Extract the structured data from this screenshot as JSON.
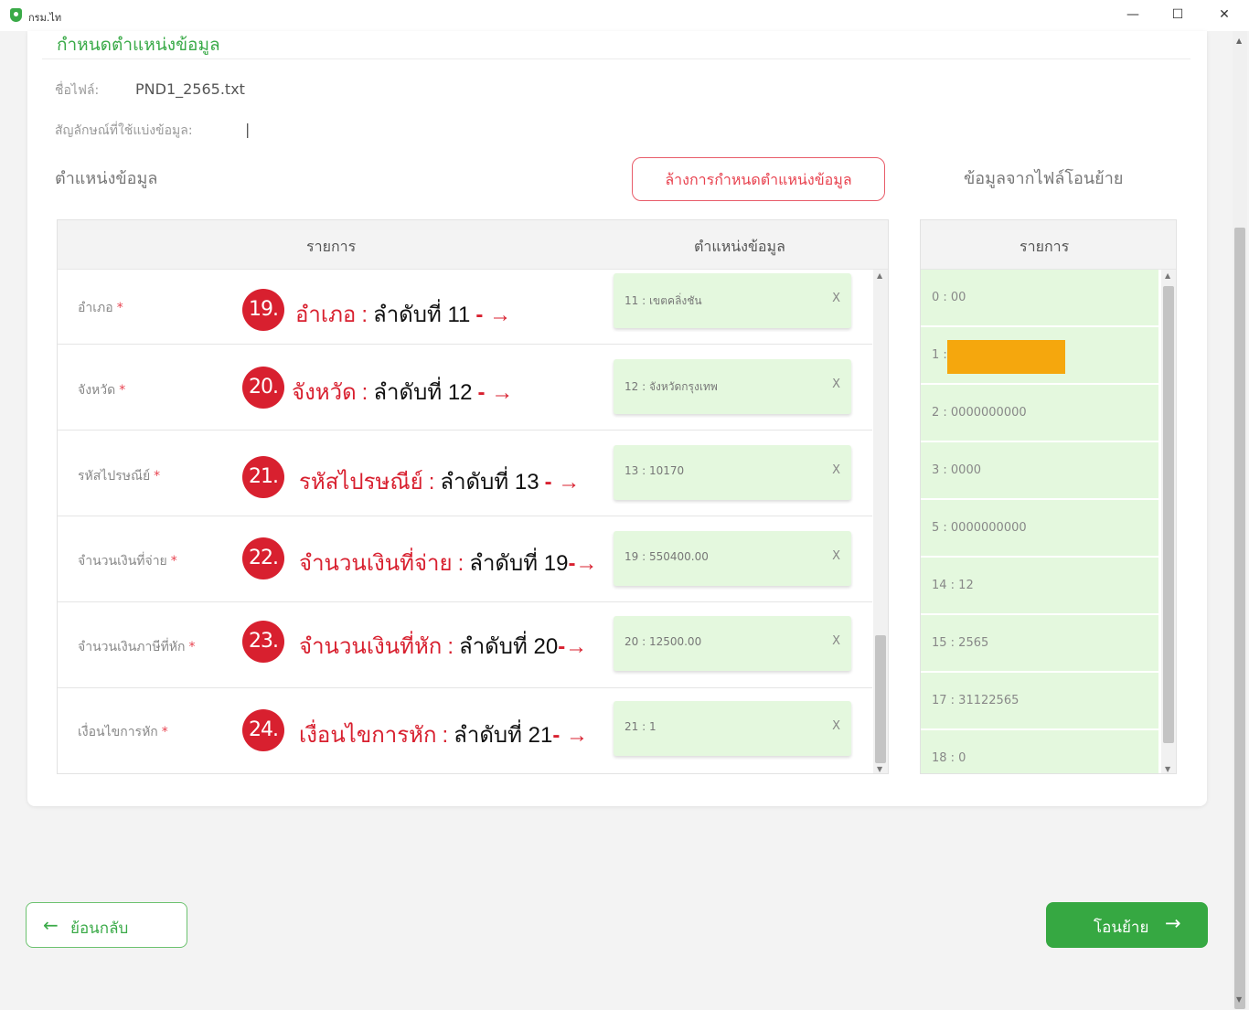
{
  "window": {
    "title": "กรม.ไท",
    "minimize": "—",
    "maximize": "☐",
    "close": "✕"
  },
  "section_title": "กำหนดตำแหน่งข้อมูล",
  "file": {
    "name_label": "ชื่อไฟล์:",
    "name_value": "PND1_2565.txt",
    "delimiter_label": "สัญลักษณ์ที่ใช้แบ่งข้อมูล:",
    "delimiter_value": "|"
  },
  "left_heading": "ตำแหน่งข้อมูล",
  "clear_button": "ล้างการกำหนดตำแหน่งข้อมูล",
  "right_heading": "ข้อมูลจากไฟล์โอนย้าย",
  "left_table": {
    "col_item": "รายการ",
    "col_position": "ตำแหน่งข้อมูล",
    "rows": [
      {
        "label": "อำเภอ",
        "required": "*",
        "mapping": "11 : เขตคลิ่งชัน",
        "remove": "X",
        "anno_num": "19.",
        "anno_name": "อำเภอ",
        "anno_colon": ":",
        "anno_order": "ลำดับที่ 11",
        "anno_arrow": "- →"
      },
      {
        "label": "จังหวัด",
        "required": "*",
        "mapping": "12 : จังหวัดกรุงเทพ",
        "remove": "X",
        "anno_num": "20.",
        "anno_name": "จังหวัด",
        "anno_colon": ":",
        "anno_order": "ลำดับที่ 12",
        "anno_arrow": "- →"
      },
      {
        "label": "รหัสไปรษณีย์",
        "required": "*",
        "mapping": "13 : 10170",
        "remove": "X",
        "anno_num": "21.",
        "anno_name": "รหัสไปรษณีย์",
        "anno_colon": ":",
        "anno_order": "ลำดับที่ 13",
        "anno_arrow": "- →"
      },
      {
        "label": "จำนวนเงินที่จ่าย",
        "required": "*",
        "mapping": "19 : 550400.00",
        "remove": "X",
        "anno_num": "22.",
        "anno_name": "จำนวนเงินที่จ่าย",
        "anno_colon": ":",
        "anno_order": "ลำดับที่ 19",
        "anno_arrow": "-→"
      },
      {
        "label": "จำนวนเงินภาษีที่หัก",
        "required": "*",
        "mapping": "20 : 12500.00",
        "remove": "X",
        "anno_num": "23.",
        "anno_name": "จำนวนเงินที่หัก",
        "anno_colon": ":",
        "anno_order": "ลำดับที่ 20",
        "anno_arrow": "-→"
      },
      {
        "label": "เงื่อนไขการหัก",
        "required": "*",
        "mapping": "21 : 1",
        "remove": "X",
        "anno_num": "24.",
        "anno_name": "เงื่อนไขการหัก",
        "anno_colon": ":",
        "anno_order": "ลำดับที่ 21",
        "anno_arrow": "- →"
      }
    ]
  },
  "right_table": {
    "col_item": "รายการ",
    "rows": [
      "0 : 00",
      "1 :",
      "2 : 0000000000",
      "3 : 0000",
      "5 : 0000000000",
      "14 : 12",
      "15 : 2565",
      "17 : 31122565",
      "18 : 0"
    ]
  },
  "buttons": {
    "back": "ย้อนกลับ",
    "back_icon": "←",
    "next": "โอนย้าย",
    "next_icon": "→"
  },
  "colors": {
    "brand_green": "#3aaa48",
    "annotation_red": "#d8202f",
    "mapped_bg": "#e4f8de",
    "redaction": "#f5a70d"
  }
}
